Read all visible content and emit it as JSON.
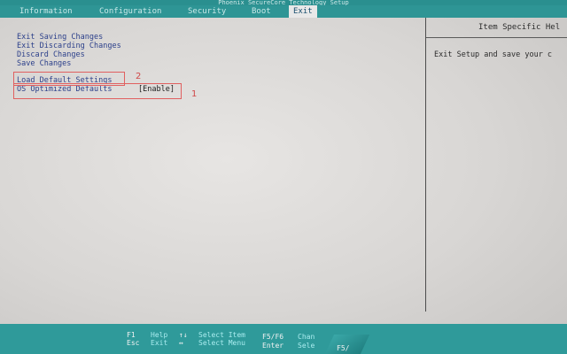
{
  "vendor_title": "Phoenix SecureCore Technology Setup",
  "menu": {
    "tabs": [
      {
        "label": "Information"
      },
      {
        "label": "Configuration"
      },
      {
        "label": "Security"
      },
      {
        "label": "Boot"
      },
      {
        "label": "Exit"
      }
    ],
    "active": "Exit"
  },
  "options": [
    {
      "label": "Exit Saving Changes"
    },
    {
      "label": "Exit Discarding Changes"
    },
    {
      "label": "Discard Changes"
    },
    {
      "label": "Save Changes"
    },
    {
      "label": "Load Default Settings"
    },
    {
      "label": "OS Optimized Defaults",
      "value": "[Enable]"
    }
  ],
  "annotations": [
    {
      "text": "2"
    },
    {
      "text": "1"
    }
  ],
  "help": {
    "title": "Item Specific Hel",
    "text": "Exit Setup and save your c"
  },
  "keys": [
    {
      "key": "F1",
      "desc": "Help"
    },
    {
      "key": "Esc",
      "desc": "Exit"
    },
    {
      "key": "↑↓",
      "desc": "Select Item"
    },
    {
      "key": "↔",
      "desc": "Select Menu"
    },
    {
      "key": "F5/F6",
      "desc": "Chan"
    },
    {
      "key": "Enter",
      "desc": "Sele"
    },
    {
      "key": "F5/",
      "desc": ""
    }
  ],
  "colors": {
    "menu_bar": "#2e9595",
    "option_text": "#2b3f8a",
    "annotation": "#d04848"
  }
}
